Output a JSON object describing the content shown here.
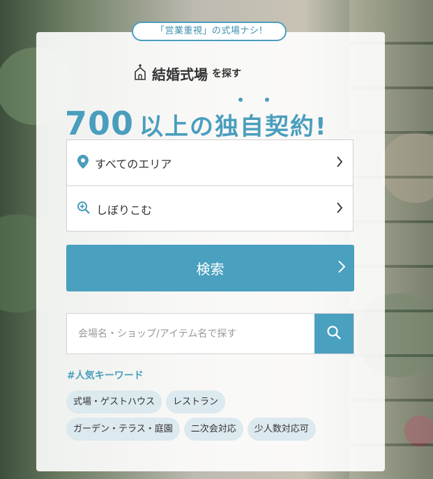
{
  "badge": "「営業重視」の式場ナシ!",
  "title": {
    "main": "結婚式場",
    "suffix": "を探す"
  },
  "headline": {
    "number": "700",
    "text": "以上の独自契約!"
  },
  "selector": {
    "area_label": "すべてのエリア",
    "filter_label": "しぼりこむ"
  },
  "search_button": "検索",
  "keyword_search": {
    "placeholder": "会場名・ショップ/アイテム名で探す"
  },
  "popular": {
    "title": "#人気キーワード",
    "tags_row1": [
      "式場・ゲストハウス",
      "レストラン"
    ],
    "tags_row2": [
      "ガーデン・テラス・庭園",
      "二次会対応",
      "少人数対応可"
    ]
  },
  "colors": {
    "accent": "#4aa0bf",
    "tag_bg": "#dce9ef",
    "text": "#333333"
  },
  "icons": [
    "church-icon",
    "location-pin-icon",
    "zoom-in-icon",
    "chevron-right-icon",
    "search-icon"
  ]
}
